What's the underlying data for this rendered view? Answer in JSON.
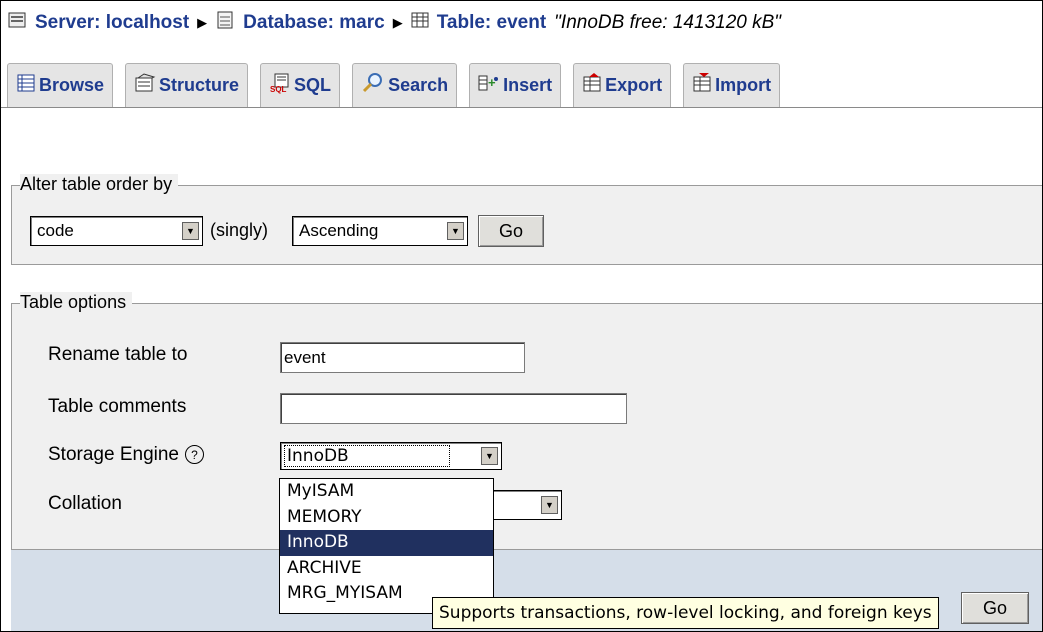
{
  "breadcrumb": {
    "server": "Server: localhost",
    "database": "Database: marc",
    "table": "Table: event",
    "note": "\"InnoDB free: 1413120 kB\"",
    "separator": "▶"
  },
  "tabs": [
    {
      "label": "Browse",
      "icon": "browse-icon"
    },
    {
      "label": "Structure",
      "icon": "structure-icon"
    },
    {
      "label": "SQL",
      "icon": "sql-icon"
    },
    {
      "label": "Search",
      "icon": "search-icon"
    },
    {
      "label": "Insert",
      "icon": "insert-icon"
    },
    {
      "label": "Export",
      "icon": "export-icon"
    },
    {
      "label": "Import",
      "icon": "import-icon"
    }
  ],
  "alter_order": {
    "legend": "Alter table order by",
    "column_value": "code",
    "singly_label": "(singly)",
    "direction_value": "Ascending",
    "go_label": "Go"
  },
  "table_options": {
    "legend": "Table options",
    "rename_label": "Rename table to",
    "rename_value": "event",
    "comments_label": "Table comments",
    "comments_value": "",
    "engine_label": "Storage Engine",
    "engine_value": "InnoDB",
    "collation_label": "Collation",
    "collation_value": "",
    "go_label": "Go"
  },
  "engine_dropdown": {
    "options": [
      "MyISAM",
      "MEMORY",
      "InnoDB",
      "ARCHIVE",
      "MRG_MYISAM"
    ],
    "selected": "InnoDB"
  },
  "tooltip": "Supports transactions, row-level locking, and foreign keys"
}
